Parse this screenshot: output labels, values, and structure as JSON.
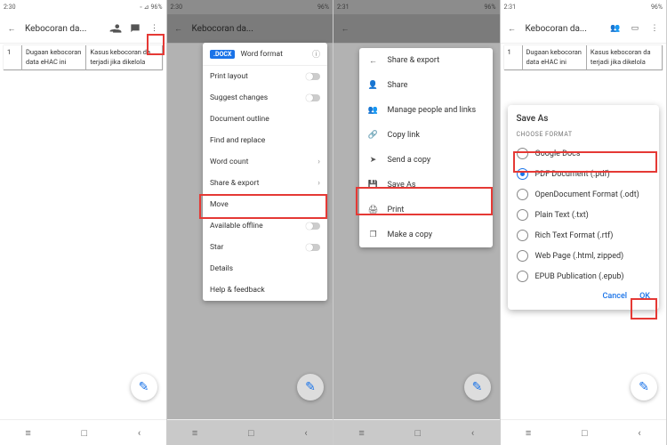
{
  "status": {
    "time": "2:30",
    "alt_time": "2:31",
    "battery": "96%",
    "icons_left": [
      "clock",
      "camera",
      "dot"
    ],
    "icons_right": [
      "nfc",
      "vowifi",
      "location",
      "signal",
      "wifi",
      "battery"
    ]
  },
  "appbar": {
    "title": "Kebocoran da...",
    "back": "←"
  },
  "doc": {
    "num": "1",
    "col1": "Dugaan kebocoran data eHAC ini",
    "col2": "Kasus kebocoran da terjadi jika dikelola"
  },
  "menu": {
    "badge": ".DOCX",
    "word_format": "Word format",
    "items": [
      "Print layout",
      "Suggest changes",
      "Document outline",
      "Find and replace",
      "Word count",
      "Share & export",
      "Move",
      "Available offline",
      "Star",
      "Details",
      "Help & feedback"
    ]
  },
  "submenu": {
    "title": "Share & export",
    "items": [
      "Share",
      "Manage people and links",
      "Copy link",
      "Send a copy",
      "Save As",
      "Print",
      "Make a copy"
    ]
  },
  "dialog": {
    "title": "Save As",
    "choose": "CHOOSE FORMAT",
    "options": [
      "Google Docs",
      "PDF Document (.pdf)",
      "OpenDocument Format (.odt)",
      "Plain Text (.txt)",
      "Rich Text Format (.rtf)",
      "Web Page (.html, zipped)",
      "EPUB Publication (.epub)"
    ],
    "cancel": "Cancel",
    "ok": "OK"
  },
  "fab": "✎"
}
